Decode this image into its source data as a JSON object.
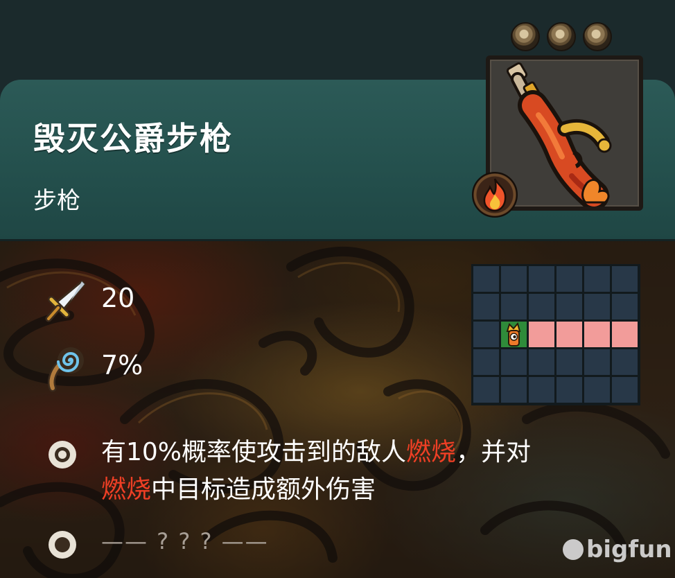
{
  "item": {
    "name": "毁灭公爵步枪",
    "type": "步枪"
  },
  "slots": {
    "filled": 0,
    "total": 3
  },
  "stats": {
    "damage": "20",
    "crit": "7%"
  },
  "range_grid": {
    "rows": 5,
    "cols": 6,
    "self_cell": [
      2,
      1
    ],
    "hit_cells": [
      [
        2,
        2
      ],
      [
        2,
        3
      ],
      [
        2,
        4
      ],
      [
        2,
        5
      ]
    ],
    "colors": {
      "empty": "#283848",
      "hit": "#f29c9a",
      "self": "#2f8b3a"
    }
  },
  "effects": {
    "line1_a": "有10%概率使攻击到的敌人",
    "line1_fire": "燃烧",
    "line1_b": "，并对",
    "line2_fire": "燃烧",
    "line2_b": "中目标造成额外伤害",
    "mystery": "—— ? ? ? ——"
  },
  "icons": {
    "damage": "sword-icon",
    "crit": "crit-spiral-icon",
    "element": "fire-icon"
  },
  "watermark": "bigfun",
  "colors": {
    "fire_text": "#ef3f25",
    "header": "#2c5a57"
  }
}
